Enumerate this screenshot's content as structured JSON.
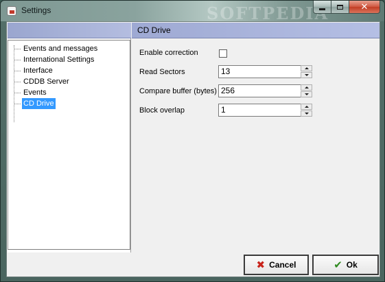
{
  "window": {
    "title": "Settings",
    "watermark": "SOFTPEDIA"
  },
  "tree": {
    "items": [
      {
        "label": "Events and messages",
        "selected": false
      },
      {
        "label": "International Settings",
        "selected": false
      },
      {
        "label": "Interface",
        "selected": false
      },
      {
        "label": "CDDB Server",
        "selected": false
      },
      {
        "label": "Events",
        "selected": false
      },
      {
        "label": "CD Drive",
        "selected": true
      }
    ]
  },
  "panel": {
    "title": "CD Drive",
    "enable_correction": {
      "label": "Enable correction",
      "checked": false
    },
    "read_sectors": {
      "label": "Read Sectors",
      "value": "13"
    },
    "compare_buffer": {
      "label": "Compare buffer (bytes)",
      "value": "256"
    },
    "block_overlap": {
      "label": "Block overlap",
      "value": "1"
    }
  },
  "buttons": {
    "cancel_label": "Cancel",
    "ok_label": "Ok"
  },
  "icons": {
    "title_icon": "settings-app-icon",
    "cancel_icon": "x-icon",
    "ok_icon": "check-icon"
  },
  "colors": {
    "selection": "#3399ff",
    "header_band": "#b4bde0",
    "cancel_red": "#c8241c",
    "ok_green": "#2e8a1f"
  }
}
